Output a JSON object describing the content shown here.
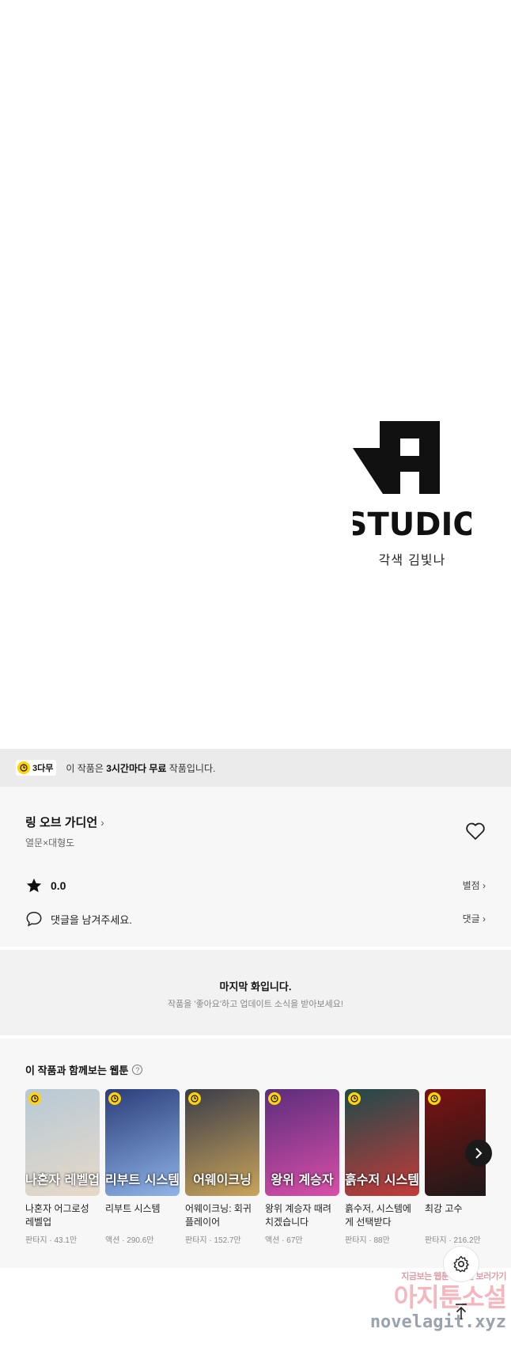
{
  "panel": {
    "logo_text": "STUDIO",
    "credit": "각색 김빛나"
  },
  "notice": {
    "badge": "3다무",
    "text_prefix": "이 작품은 ",
    "text_bold1": "3시간마다 무료",
    "text_suffix": " 작품입니다."
  },
  "info": {
    "title": "링 오브 가디언",
    "author": "열문×대형도",
    "rating": "0.0",
    "rate_link": "별점",
    "comment_prompt": "댓글을 남겨주세요.",
    "comment_link": "댓글"
  },
  "last_episode": {
    "title": "마지막 화입니다.",
    "subtitle": "작품을 '좋아요'하고 업데이트 소식을 받아보세요!"
  },
  "recommendations": {
    "title": "이 작품과 함께보는 웹툰",
    "items": [
      {
        "title": "나혼자 어그로성 레벨업",
        "meta": "판타지 · 43.1만",
        "thumb_label": "나혼자 레벨업",
        "color1": "#b7c9d6",
        "color2": "#e7d9c8"
      },
      {
        "title": "리부트 시스템",
        "meta": "액션 · 290.6만",
        "thumb_label": "리부트 시스템",
        "color1": "#2b3d7a",
        "color2": "#8fb4e8"
      },
      {
        "title": "어웨이크닝: 회귀 플레이어",
        "meta": "판타지 · 152.7만",
        "thumb_label": "어웨이크닝",
        "color1": "#3a3d4a",
        "color2": "#c9a45a"
      },
      {
        "title": "왕위 계승자 때려치겠습니다",
        "meta": "액션 · 67만",
        "thumb_label": "왕위 계승자",
        "color1": "#5b2d7d",
        "color2": "#d94fa7"
      },
      {
        "title": "흙수저, 시스템에게 선택받다",
        "meta": "판타지 · 88만",
        "thumb_label": "흙수저 시스템",
        "color1": "#1f4a4a",
        "color2": "#c53a3a"
      },
      {
        "title": "최강 고수",
        "meta": "판타지 · 216.2만",
        "thumb_label": "",
        "color1": "#7a1212",
        "color2": "#1a1a1a"
      }
    ]
  },
  "watermark": {
    "line1": "지금보는 웹툰 웹소설 보러가기",
    "line2": "아지툰소설",
    "line3": "novelagit.xyz"
  }
}
